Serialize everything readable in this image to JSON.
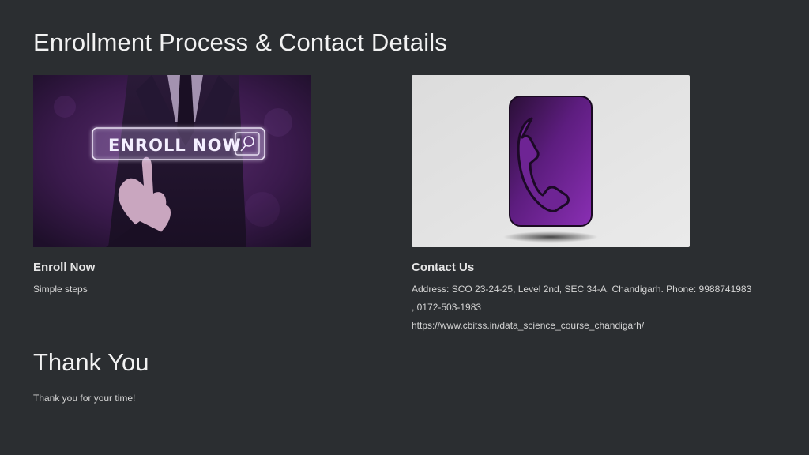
{
  "slide": {
    "title": "Enrollment Process & Contact Details",
    "enroll": {
      "image_text": "ENROLL NOW",
      "heading": "Enroll Now",
      "text": "Simple steps"
    },
    "contact": {
      "heading": "Contact Us",
      "address_line1": "Address: SCO 23-24-25, Level 2nd, SEC 34-A, Chandigarh. Phone: 9988741983",
      "address_line2": ", 0172-503-1983",
      "url": "https://www.cbitss.in/data_science_course_chandigarh/"
    },
    "thanks": {
      "title": "Thank You",
      "text": "Thank you for your time!"
    }
  },
  "colors": {
    "background": "#2b2e31",
    "accent_purple": "#7b2d9e"
  },
  "icons": {
    "enroll_search": "search-icon",
    "contact_phone": "phone-icon"
  }
}
